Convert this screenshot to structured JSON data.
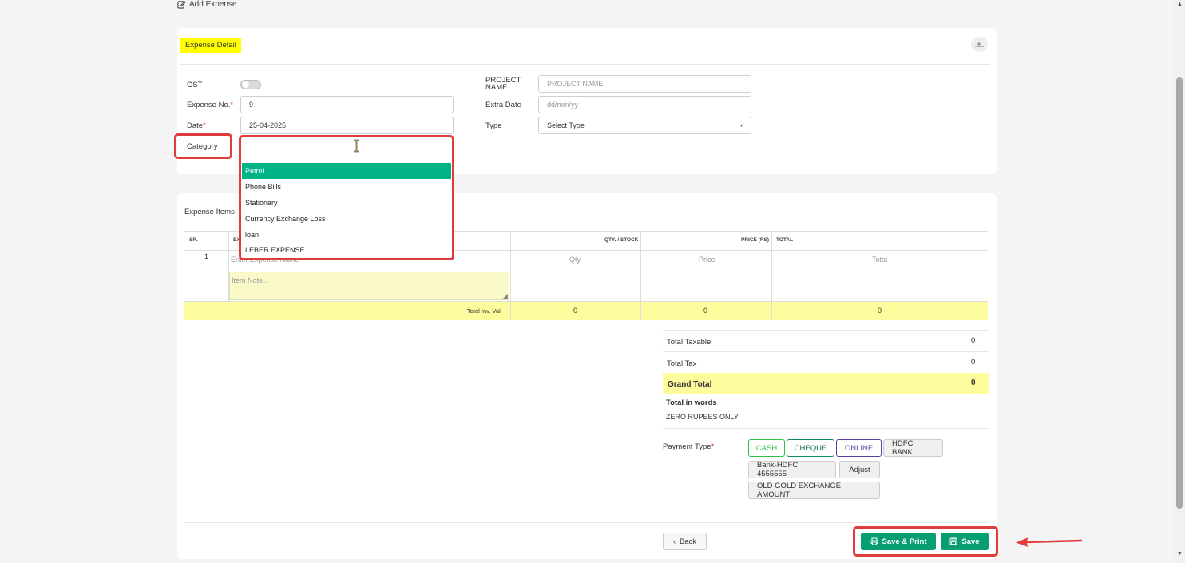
{
  "page": {
    "title": "Add Expense"
  },
  "detail": {
    "section_title": "Expense Detail",
    "gst_label": "GST",
    "expense_no_label": "Expense No.",
    "expense_no_value": "9",
    "date_label": "Date",
    "date_value": "25-04-2025",
    "category_label": "Category",
    "required_mark": "*",
    "project_name_label_1": "PROJECT",
    "project_name_label_2": "NAME",
    "project_name_placeholder": "PROJECT NAME",
    "extra_date_label": "Extra Date",
    "extra_date_placeholder": "dd/mm/yy",
    "type_label": "Type",
    "type_value": "Select Type"
  },
  "category_dropdown": {
    "options": [
      "Petrol",
      "Phone Bills",
      "Stationary",
      "Currency Exchange Loss",
      "loan",
      "LEBER EXPENSE"
    ],
    "selected": "Petrol"
  },
  "items": {
    "section_title": "Expense Items",
    "headers": {
      "sr": "SR.",
      "expense_trunc": "EX",
      "qty": "QTY. / STOCK",
      "price": "PRICE (RS)",
      "total": "TOTAL"
    },
    "row": {
      "sr": "1",
      "name_placeholder": "Enter Expense Name",
      "note_placeholder": "Item Note...",
      "qty_placeholder": "Qty.",
      "price_placeholder": "Price",
      "total_placeholder": "Total"
    },
    "totals_row": {
      "label": "Total Inv. Val",
      "qty": "0",
      "price": "0",
      "total": "0"
    }
  },
  "summary": {
    "total_taxable_label": "Total Taxable",
    "total_taxable_value": "0",
    "total_tax_label": "Total Tax",
    "total_tax_value": "0",
    "grand_total_label": "Grand Total",
    "grand_total_value": "0",
    "words_label": "Total in words",
    "words_value": "ZERO RUPEES ONLY"
  },
  "payment": {
    "label": "Payment Type",
    "options": [
      "CASH",
      "CHEQUE",
      "ONLINE",
      "HDFC BANK",
      "Bank-HDFC 4555555",
      "Adjust",
      "OLD GOLD EXCHANGE AMOUNT"
    ]
  },
  "footer": {
    "back": "Back",
    "save_print": "Save & Print",
    "save": "Save"
  },
  "colors": {
    "accent": "#079e74",
    "highlight": "#ffff00",
    "annotation": "#e23b3b",
    "cash": "#2fbf4a",
    "cheque": "#0b8a6a",
    "online": "#5b3fa6"
  }
}
